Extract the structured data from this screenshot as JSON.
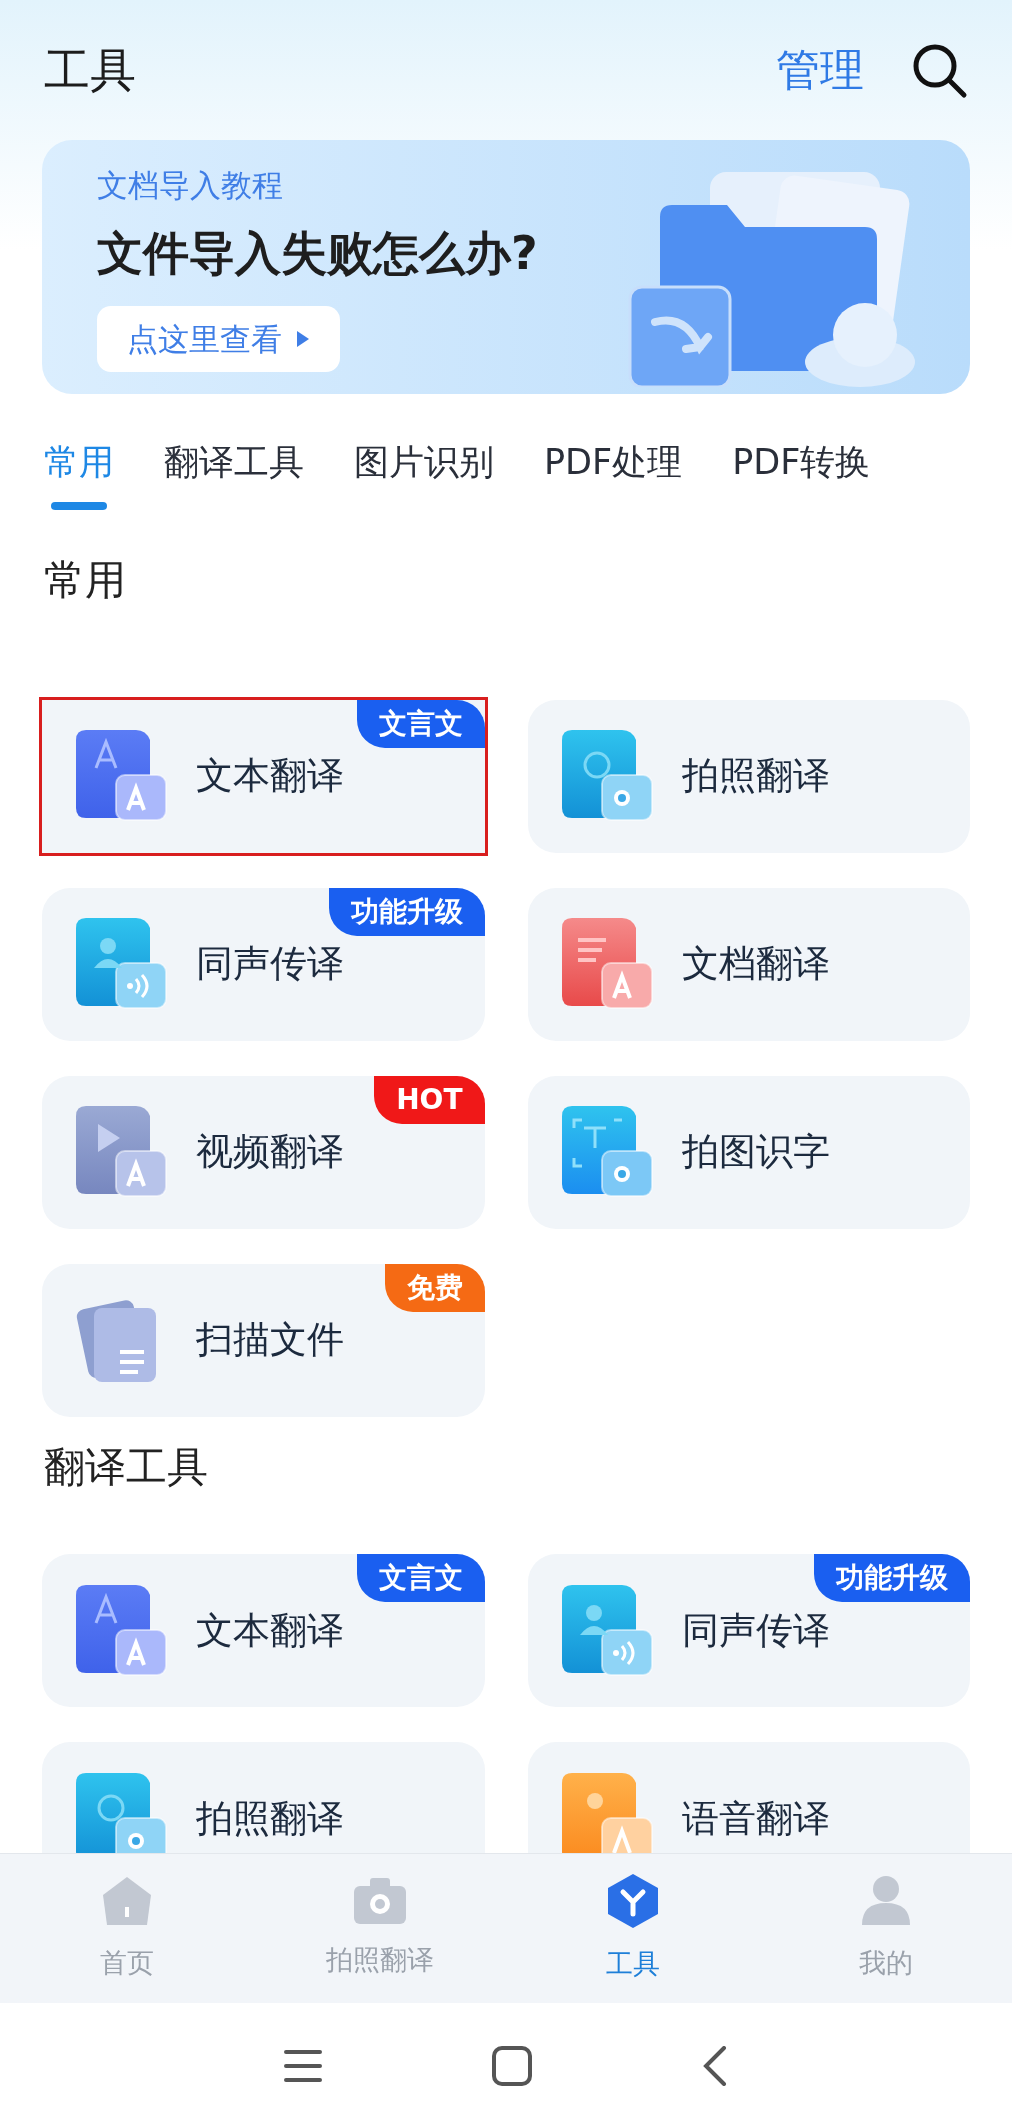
{
  "header": {
    "title": "工具",
    "manage": "管理"
  },
  "banner": {
    "subtitle": "文档导入教程",
    "title": "文件导入失败怎么办?",
    "button": "点这里查看"
  },
  "tabs": [
    {
      "label": "常用",
      "selected": true
    },
    {
      "label": "翻译工具",
      "selected": false
    },
    {
      "label": "图片识别",
      "selected": false
    },
    {
      "label": "PDF处理",
      "selected": false
    },
    {
      "label": "PDF转换",
      "selected": false
    }
  ],
  "sections": [
    {
      "title": "常用",
      "items": [
        {
          "label": "文本翻译",
          "kind": "text",
          "highlighted": true,
          "badge": {
            "text": "文言文",
            "color": "#1a5ff0"
          }
        },
        {
          "label": "拍照翻译",
          "kind": "camera",
          "highlighted": false
        },
        {
          "label": "同声传译",
          "kind": "voice",
          "highlighted": false,
          "badge": {
            "text": "功能升级",
            "color": "#1a5ff0"
          }
        },
        {
          "label": "文档翻译",
          "kind": "doc",
          "highlighted": false
        },
        {
          "label": "视频翻译",
          "kind": "video",
          "highlighted": false,
          "badge": {
            "text": "HOT",
            "color": "#f01818"
          }
        },
        {
          "label": "拍图识字",
          "kind": "ocr",
          "highlighted": false
        },
        {
          "label": "扫描文件",
          "kind": "scan",
          "highlighted": false,
          "badge": {
            "text": "免费",
            "color": "#f56a14"
          }
        }
      ]
    },
    {
      "title": "翻译工具",
      "items": [
        {
          "label": "文本翻译",
          "kind": "text",
          "highlighted": false,
          "badge": {
            "text": "文言文",
            "color": "#1a5ff0"
          }
        },
        {
          "label": "同声传译",
          "kind": "voice",
          "highlighted": false,
          "badge": {
            "text": "功能升级",
            "color": "#1a5ff0"
          }
        },
        {
          "label": "拍照翻译",
          "kind": "camera",
          "highlighted": false
        },
        {
          "label": "语音翻译",
          "kind": "audio",
          "highlighted": false
        }
      ]
    }
  ],
  "bottom_nav": [
    {
      "label": "首页",
      "kind": "home",
      "selected": false
    },
    {
      "label": "拍照翻译",
      "kind": "camera",
      "selected": false
    },
    {
      "label": "工具",
      "kind": "tools",
      "selected": true
    },
    {
      "label": "我的",
      "kind": "profile",
      "selected": false
    }
  ]
}
